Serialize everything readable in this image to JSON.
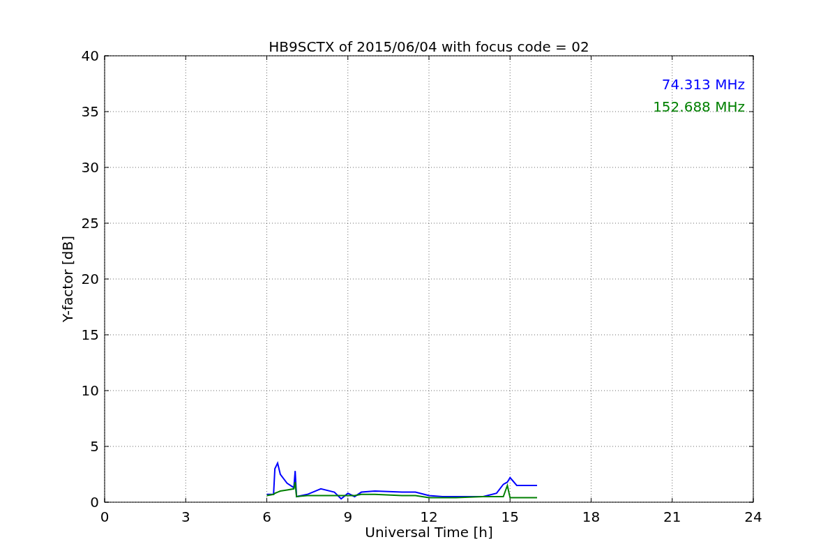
{
  "chart_data": {
    "type": "line",
    "title": "HB9SCTX of 2015/06/04 with focus code = 02",
    "xlabel": "Universal Time [h]",
    "ylabel": "Y-factor [dB]",
    "x": [
      6,
      6.25,
      6.3,
      6.4,
      6.5,
      6.75,
      7,
      7.05,
      7.1,
      7.5,
      8,
      8.5,
      8.75,
      9,
      9.25,
      9.5,
      10,
      11,
      11.5,
      12,
      12.5,
      13,
      14,
      14.5,
      14.75,
      14.9,
      15,
      15.25,
      16
    ],
    "series": [
      {
        "name": "74.313 MHz",
        "color": "#0000ff",
        "values": [
          0.7,
          0.7,
          3,
          3.5,
          2.5,
          1.7,
          1.3,
          2.8,
          0.5,
          0.7,
          1.2,
          0.9,
          0.3,
          0.8,
          0.5,
          0.9,
          1.0,
          0.9,
          0.9,
          0.6,
          0.5,
          0.5,
          0.5,
          0.8,
          1.6,
          1.8,
          2.2,
          1.5,
          1.5
        ]
      },
      {
        "name": "152.688 MHz",
        "color": "#008000",
        "values": [
          0.6,
          0.7,
          0.8,
          0.9,
          1.0,
          1.1,
          1.2,
          1.8,
          0.5,
          0.6,
          0.6,
          0.6,
          0.6,
          0.6,
          0.6,
          0.7,
          0.7,
          0.6,
          0.6,
          0.4,
          0.4,
          0.4,
          0.5,
          0.5,
          0.5,
          1.5,
          0.4,
          0.4,
          0.4
        ]
      }
    ],
    "grid": true,
    "xlim": [
      0,
      24
    ],
    "ylim": [
      0,
      40
    ],
    "xticks": [
      0,
      3,
      6,
      9,
      12,
      15,
      18,
      21,
      24
    ],
    "yticks": [
      0,
      5,
      10,
      15,
      20,
      25,
      30,
      35,
      40
    ]
  }
}
